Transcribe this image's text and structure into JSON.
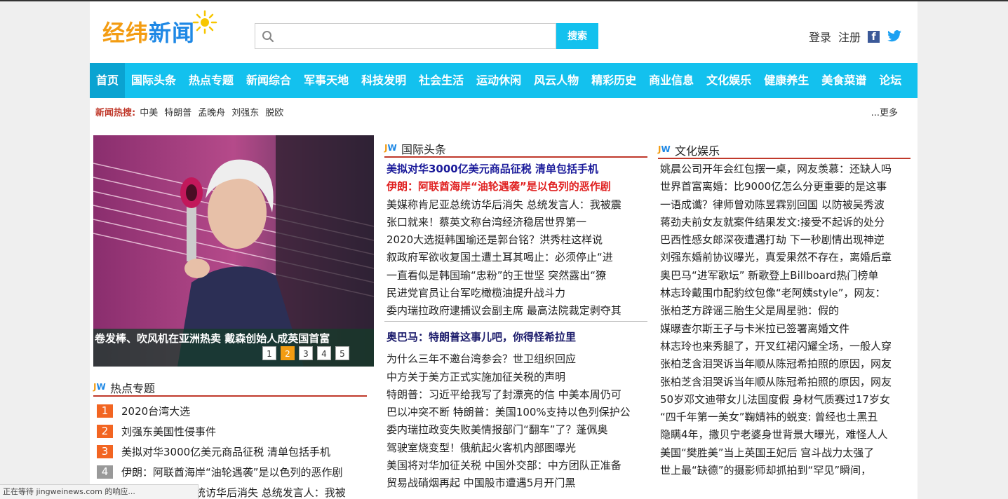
{
  "header": {
    "logo_text_1": "经纬",
    "logo_text_2": "新闻",
    "search_placeholder": "",
    "search_button": "搜索",
    "login": "登录",
    "register": "注册"
  },
  "nav": [
    "首页",
    "国际头条",
    "热点专题",
    "新闻综合",
    "军事天地",
    "科技发明",
    "社会生活",
    "运动休闲",
    "风云人物",
    "精彩历史",
    "商业信息",
    "文化娱乐",
    "健康养生",
    "美食菜谱",
    "论坛"
  ],
  "hot": {
    "label": "新闻热搜:",
    "keywords": [
      "中美",
      "特朗普",
      "孟晚舟",
      "刘强东",
      "脱欧"
    ],
    "more": "...更多"
  },
  "slider": {
    "caption": "卷发棒、吹风机在亚洲热卖 戴森创始人成英国首富",
    "pages": [
      "1",
      "2",
      "3",
      "4",
      "5"
    ],
    "active_page": "2"
  },
  "sections": {
    "jw_j": "J",
    "jw_w": "W",
    "hot_topics": "热点专题",
    "international": "国际头条",
    "entertainment": "文化娱乐"
  },
  "hot_topics": [
    {
      "n": "1",
      "text": "2020台湾大选"
    },
    {
      "n": "2",
      "text": "刘强东美国性侵事件"
    },
    {
      "n": "3",
      "text": "美拟对华3000亿美元商品征税 清单包括手机"
    },
    {
      "n": "4",
      "text": "伊朗：阿联酋海岸“油轮遇袭”是以色列的恶作剧"
    },
    {
      "n": "5",
      "text": "美媒称肯尼亚总统访华后消失 总统发言人：我被"
    }
  ],
  "international_1": [
    "美拟对华3000亿美元商品征税 清单包括手机",
    "伊朗：阿联酋海岸“油轮遇袭”是以色列的恶作剧",
    "美媒称肯尼亚总统访华后消失 总统发言人：我被震",
    "张口就来！蔡英文称台湾经济稳居世界第一",
    "2020大选挺韩国瑜还是郭台铭？洪秀柱这样说",
    "叙政府军欲收复国土遭土耳其喝止：必须停止“进",
    "一直看似是韩国瑜“忠粉”的王世坚 突然露出“獠",
    "民进党官员让台军吃橄榄油提升战斗力",
    "委内瑞拉政府逮捕议会副主席 最高法院裁定剥夺其"
  ],
  "international_2_title": "奥巴马：特朗普这事儿吧，你得怪希拉里",
  "international_2": [
    "为什么三年不邀台湾参会？世卫组织回应",
    "中方关于美方正式实施加征关税的声明",
    "特朗普：习近平给我写了封漂亮的信 中美本周仍可",
    "巴以冲突不断 特朗普：美国100%支持以色列保护公",
    "委内瑞拉政变失败美情报部门“翻车”了？蓬佩奥",
    "驾驶室烧变型！俄航起火客机内部图曝光",
    "美国将对华加征关税 中国外交部：中方团队正准备",
    "贸易战硝烟再起 中国股市遭遇5月开门黑"
  ],
  "entertainment": [
    "姚晨公司开年会红包摆一桌，网友羡慕：还缺人吗",
    "世界首富离婚：比9000亿怎么分更重要的是这事",
    "一语成谶？律师曾劝陈昱霖别回国 以防被吴秀波",
    "蒋劲夫前女友就案件结果发文:接受不起诉的处分",
    "巴西性感女郎深夜遭遇打劫 下一秒剧情出现神逆",
    "刘强东婚前协议曝光，真爱果然不存在，离婚后章",
    "奥巴马“进军歌坛” 新歌登上Billboard热门榜单",
    "林志玲戴围巾配豹纹包像“老阿姨style”，网友：",
    "张柏芝方辟谣三胎生父是周星驰：假的",
    "媒曝查尔斯王子与卡米拉已签署离婚文件",
    "林志玲也来秀腿了，开叉红裙闪耀全场，一般人穿",
    "张柏芝含泪哭诉当年顺从陈冠希拍照的原因，网友",
    "张柏芝含泪哭诉当年顺从陈冠希拍照的原因，网友",
    "50岁邓文迪带女儿法国度假 身材气质赛过17岁女",
    "“四千年第一美女”鞠婧祎的蜕变: 曾经也土黑丑",
    "隐瞒4年，撒贝宁老婆身世背景大曝光，难怪人人",
    "美国“樊胜美”当上英国王妃后 宫斗战力太强了",
    "世上最“缺德”的摄影师却抓拍到“罕见”瞬间，"
  ],
  "status_bar": "正在等待 jingweinews.com 的响应..."
}
